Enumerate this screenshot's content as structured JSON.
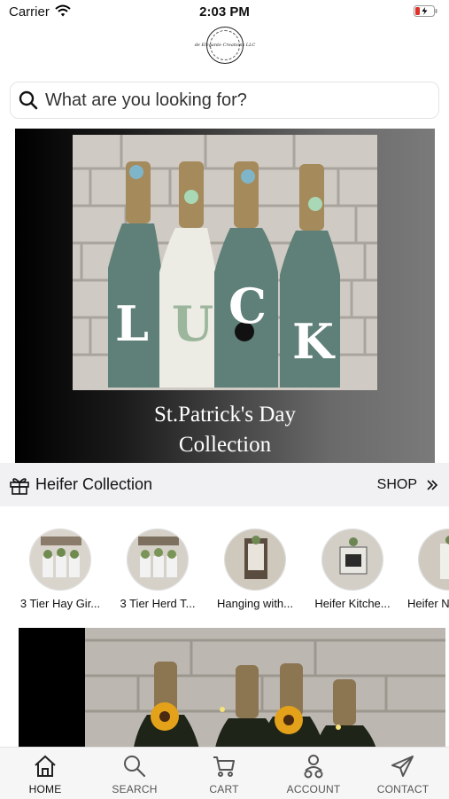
{
  "status_bar": {
    "carrier": "Carrier",
    "time": "2:03 PM"
  },
  "logo": {
    "text": "de Elegante Creations LLC"
  },
  "search": {
    "placeholder": "What are you looking for?"
  },
  "hero": {
    "caption_line1": "St.Patrick's Day",
    "caption_line2": "Collection",
    "bottle_letters": [
      "L",
      "U",
      "C",
      "K"
    ]
  },
  "collection": {
    "title": "Heifer Collection",
    "shop_label": "SHOP"
  },
  "products": [
    {
      "name": "3 Tier Hay Gir..."
    },
    {
      "name": "3 Tier Herd T..."
    },
    {
      "name": "Hanging with..."
    },
    {
      "name": "Heifer Kitche..."
    },
    {
      "name": "Heifer N"
    }
  ],
  "tabs": [
    {
      "label": "HOME",
      "icon": "home-icon",
      "active": true
    },
    {
      "label": "SEARCH",
      "icon": "search-icon",
      "active": false
    },
    {
      "label": "CART",
      "icon": "cart-icon",
      "active": false
    },
    {
      "label": "ACCOUNT",
      "icon": "account-icon",
      "active": false
    },
    {
      "label": "CONTACT",
      "icon": "send-icon",
      "active": false
    }
  ],
  "colors": {
    "collection_bar_bg": "#f1f1f3",
    "tabbar_bg": "#f6f6f6",
    "bottle_teal": "#5e8078",
    "bottle_white": "#ecebe4",
    "battery_red": "#e0312a"
  }
}
